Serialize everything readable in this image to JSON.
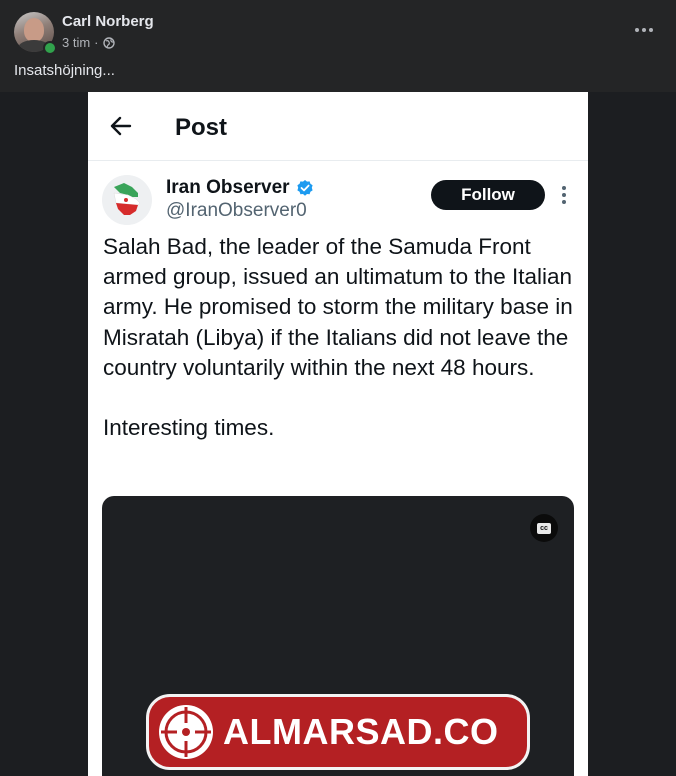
{
  "post": {
    "author": "Carl Norberg",
    "time": "3 tim",
    "separator": "·",
    "caption": "Insatshöjning..."
  },
  "tweet": {
    "page_title": "Post",
    "display_name": "Iran Observer",
    "handle": "@IranObserver0",
    "follow_label": "Follow",
    "text_paragraph_1": "Salah Bad, the leader of the Samuda Front armed group, issued an ultimatum to the Italian army. He promised to storm the military base in Misratah (Libya) if the Italians did not leave the country voluntarily within the next 48 hours.",
    "text_paragraph_2": "Interesting times.",
    "video": {
      "cc_label": "cc",
      "watermark_text": "ALMARSAD.CO"
    }
  },
  "colors": {
    "page_bg": "#1c1e21",
    "header_bg": "#242526",
    "online": "#31a24c",
    "verified": "#1d9bf0",
    "watermark": "#b42023"
  },
  "icons": [
    "globe-icon",
    "more-icon",
    "back-arrow-icon",
    "verified-icon",
    "kebab-icon",
    "cc-icon",
    "watermark-logo"
  ]
}
